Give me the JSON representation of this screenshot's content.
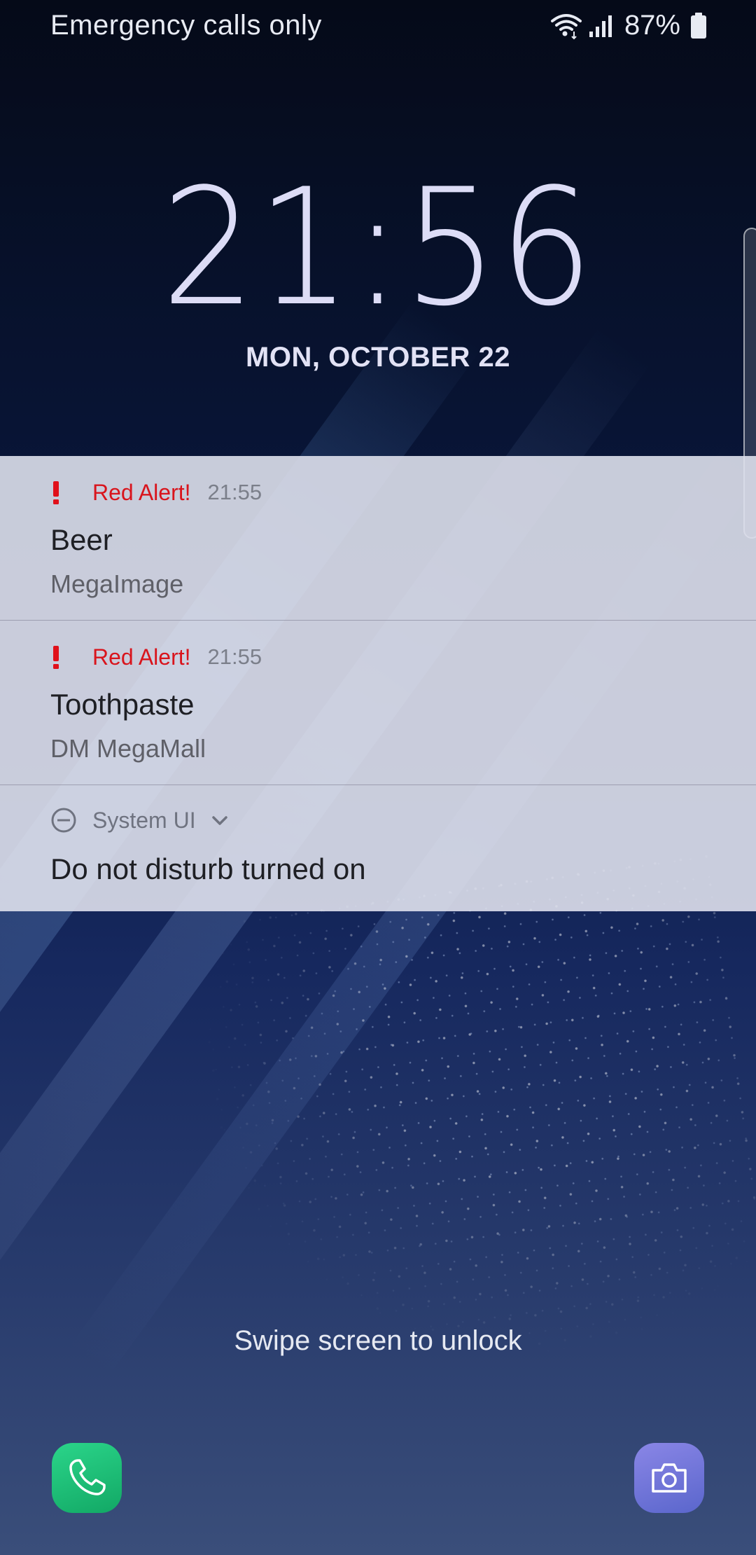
{
  "status_bar": {
    "carrier_text": "Emergency calls only",
    "battery_percent": "87%",
    "icons": [
      "wifi-icon",
      "signal-icon",
      "battery-icon"
    ]
  },
  "lock": {
    "time": "21:56",
    "date": "MON, OCTOBER 22",
    "unlock_hint": "Swipe screen to unlock"
  },
  "notifications": [
    {
      "app": "Red Alert!",
      "time": "21:55",
      "title": "Beer",
      "body": "MegaImage",
      "icon": "exclamation-icon"
    },
    {
      "app": "Red Alert!",
      "time": "21:55",
      "title": "Toothpaste",
      "body": "DM MegaMall",
      "icon": "exclamation-icon"
    },
    {
      "app": "System UI",
      "title": "Do not disturb turned on",
      "icon": "do-not-disturb-icon"
    }
  ],
  "shortcuts": [
    {
      "name": "phone",
      "icon": "phone-icon"
    },
    {
      "name": "camera",
      "icon": "camera-icon"
    }
  ],
  "colors": {
    "alert_red": "#d9141c",
    "phone_green": "#1fbf78",
    "camera_purple": "#7278d8"
  }
}
